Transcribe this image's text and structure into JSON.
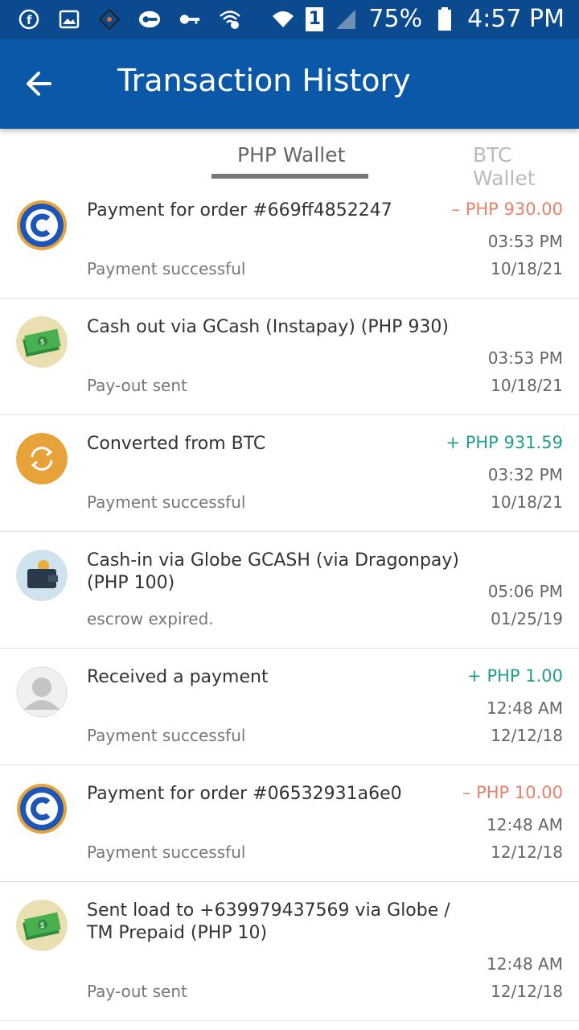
{
  "status_bar": {
    "battery": "75%",
    "time": "4:57 PM",
    "sim": "1"
  },
  "app_bar": {
    "title": "Transaction History"
  },
  "tabs": [
    {
      "label": "PHP Wallet",
      "active": true
    },
    {
      "label": "BTC Wallet",
      "active": false
    }
  ],
  "transactions": [
    {
      "icon": "coinsph-logo-icon",
      "description": "Payment for order #669ff4852247",
      "amount": "– PHP 930.00",
      "amount_type": "negative",
      "time": "03:53 PM",
      "status": "Payment successful",
      "date": "10/18/21"
    },
    {
      "icon": "cash-money-icon",
      "description": "Cash out via GCash (Instapay) (PHP 930)",
      "amount": "",
      "amount_type": "none",
      "time": "03:53 PM",
      "status": "Pay-out sent",
      "date": "10/18/21"
    },
    {
      "icon": "convert-icon",
      "description": "Converted from BTC",
      "amount": "+ PHP 931.59",
      "amount_type": "positive",
      "time": "03:32 PM",
      "status": "Payment successful",
      "date": "10/18/21"
    },
    {
      "icon": "wallet-icon",
      "description": "Cash-in via Globe GCASH (via Dragonpay) (PHP 100)",
      "amount": "",
      "amount_type": "none",
      "time": "05:06 PM",
      "status": "escrow expired.",
      "date": "01/25/19"
    },
    {
      "icon": "user-avatar-icon",
      "description": "Received a payment",
      "amount": "+ PHP 1.00",
      "amount_type": "positive",
      "time": "12:48 AM",
      "status": "Payment successful",
      "date": "12/12/18"
    },
    {
      "icon": "coinsph-logo-icon",
      "description": "Payment for order #06532931a6e0",
      "amount": "– PHP 10.00",
      "amount_type": "negative",
      "time": "12:48 AM",
      "status": "Payment successful",
      "date": "12/12/18"
    },
    {
      "icon": "cash-money-icon",
      "description": "Sent load to +639979437569 via Globe / TM Prepaid (PHP 10)",
      "amount": "",
      "amount_type": "none",
      "time": "12:48 AM",
      "status": "Pay-out sent",
      "date": "12/12/18"
    }
  ],
  "colors": {
    "app_bar": "#0b57a8",
    "status_bar": "#0b4a8e",
    "negative": "#e8806a",
    "positive": "#1f9e8c"
  }
}
